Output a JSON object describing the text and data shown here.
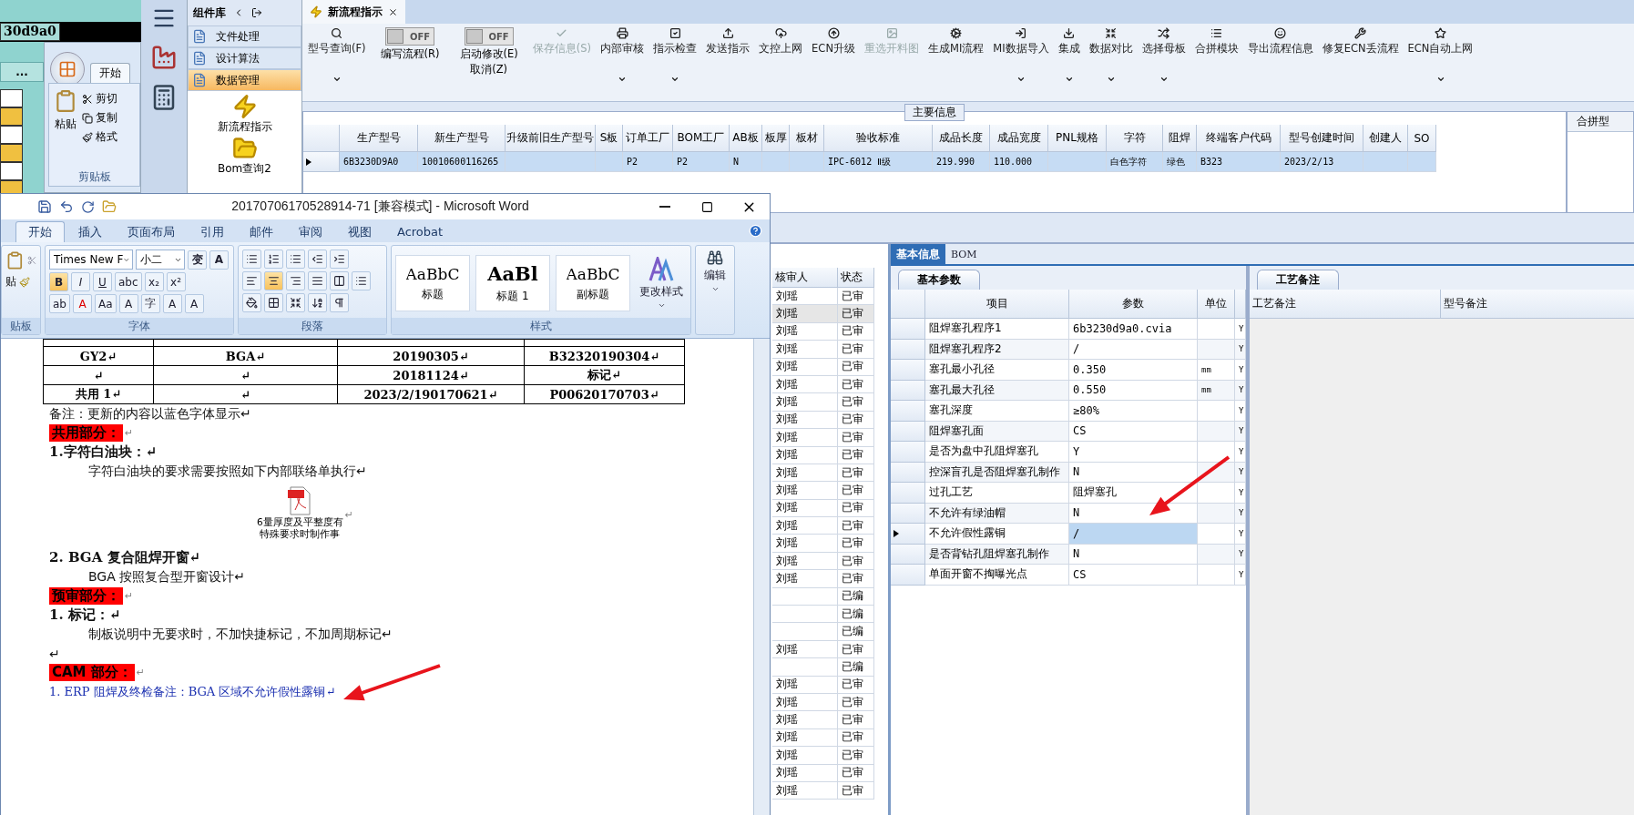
{
  "background_app": {
    "field_value": "30d9a0",
    "more_button": "...",
    "word": {
      "tab": "开始",
      "paste": "粘贴",
      "clipboard_items": [
        "剪切",
        "复制",
        "格式"
      ],
      "group": "剪贴板"
    }
  },
  "component_library": {
    "title": "组件库",
    "items": [
      {
        "label": "文件处理",
        "selected": false
      },
      {
        "label": "设计算法",
        "selected": false
      },
      {
        "label": "数据管理",
        "selected": true
      }
    ],
    "shortcuts": [
      "新流程指示",
      "Bom查询2"
    ]
  },
  "main": {
    "tab": {
      "title": "新流程指示"
    },
    "toolbar": [
      {
        "kind": "button",
        "label": "型号查询(F)",
        "dropdown": true,
        "disabled": false
      },
      {
        "kind": "toggle",
        "text": "OFF",
        "on": false,
        "lines": [
          "编写流程(R)"
        ]
      },
      {
        "kind": "toggle",
        "text": "OFF",
        "on": false,
        "lines": [
          "启动修改(E)",
          "取消(Z)"
        ]
      },
      {
        "kind": "button",
        "label": "保存信息(S)",
        "dropdown": false,
        "disabled": true
      },
      {
        "kind": "button",
        "label": "内部审核",
        "dropdown": true,
        "disabled": false
      },
      {
        "kind": "button",
        "label": "指示检查",
        "dropdown": true,
        "disabled": false
      },
      {
        "kind": "button",
        "label": "发送指示",
        "dropdown": false,
        "disabled": false
      },
      {
        "kind": "button",
        "label": "文控上网",
        "dropdown": false,
        "disabled": false
      },
      {
        "kind": "button",
        "label": "ECN升级",
        "dropdown": false,
        "disabled": false
      },
      {
        "kind": "button",
        "label": "重选开料图",
        "dropdown": false,
        "disabled": true
      },
      {
        "kind": "button",
        "label": "生成MI流程",
        "dropdown": false,
        "disabled": false
      },
      {
        "kind": "button",
        "label": "MI数据导入",
        "dropdown": true,
        "disabled": false
      },
      {
        "kind": "button",
        "label": "集成",
        "dropdown": true,
        "disabled": false
      },
      {
        "kind": "button",
        "label": "数据对比",
        "dropdown": true,
        "disabled": false
      },
      {
        "kind": "button",
        "label": "选择母板",
        "dropdown": true,
        "disabled": false
      },
      {
        "kind": "button",
        "label": "合拼模块",
        "dropdown": false,
        "disabled": false
      },
      {
        "kind": "button",
        "label": "导出流程信息",
        "dropdown": false,
        "disabled": false
      },
      {
        "kind": "button",
        "label": "修复ECN丢流程",
        "dropdown": false,
        "disabled": false
      },
      {
        "kind": "button",
        "label": "ECN自动上网",
        "dropdown": true,
        "disabled": false
      }
    ],
    "main_info": {
      "title": "主要信息",
      "columns": [
        "生产型号",
        "新生产型号",
        "升级前旧生产型号",
        "S板",
        "订单工厂",
        "BOM工厂",
        "AB板",
        "板厚",
        "板材",
        "验收标准",
        "成品长度",
        "成品宽度",
        "PNL规格",
        "字符",
        "阻焊",
        "终端客户代码",
        "型号创建时间",
        "创建人",
        "SO"
      ],
      "rows": [
        {
          "selected": true,
          "cells": [
            "6B3230D9A0",
            "10010600116265",
            "",
            "",
            "P2",
            "P2",
            "N",
            "",
            "",
            "IPC-6012 Ⅱ级",
            "219.990",
            "110.000",
            "",
            "白色字符",
            "绿色",
            "B323",
            "2023/2/13",
            "",
            ""
          ]
        }
      ]
    },
    "side_panel": {
      "title": "合拼型"
    }
  },
  "review_list": {
    "columns": [
      "核审人",
      "状态"
    ],
    "rows": [
      {
        "cells": [
          "刘瑶",
          "已审"
        ],
        "selected": false
      },
      {
        "cells": [
          "刘瑶",
          "已审"
        ],
        "selected": true
      },
      {
        "cells": [
          "刘瑶",
          "已审"
        ],
        "selected": false
      },
      {
        "cells": [
          "刘瑶",
          "已审"
        ],
        "selected": false
      },
      {
        "cells": [
          "刘瑶",
          "已审"
        ],
        "selected": false
      },
      {
        "cells": [
          "刘瑶",
          "已审"
        ],
        "selected": false
      },
      {
        "cells": [
          "刘瑶",
          "已审"
        ],
        "selected": false
      },
      {
        "cells": [
          "刘瑶",
          "已审"
        ],
        "selected": false
      },
      {
        "cells": [
          "刘瑶",
          "已审"
        ],
        "selected": false
      },
      {
        "cells": [
          "刘瑶",
          "已审"
        ],
        "selected": false
      },
      {
        "cells": [
          "刘瑶",
          "已审"
        ],
        "selected": false
      },
      {
        "cells": [
          "刘瑶",
          "已审"
        ],
        "selected": false
      },
      {
        "cells": [
          "刘瑶",
          "已审"
        ],
        "selected": false
      },
      {
        "cells": [
          "刘瑶",
          "已审"
        ],
        "selected": false
      },
      {
        "cells": [
          "刘瑶",
          "已审"
        ],
        "selected": false
      },
      {
        "cells": [
          "刘瑶",
          "已审"
        ],
        "selected": false
      },
      {
        "cells": [
          "刘瑶",
          "已审"
        ],
        "selected": false
      },
      {
        "cells": [
          "",
          "已编"
        ],
        "selected": false
      },
      {
        "cells": [
          "",
          "已编"
        ],
        "selected": false
      },
      {
        "cells": [
          "",
          "已编"
        ],
        "selected": false
      },
      {
        "cells": [
          "刘瑶",
          "已审"
        ],
        "selected": false
      },
      {
        "cells": [
          "",
          "已编"
        ],
        "selected": false
      },
      {
        "cells": [
          "刘瑶",
          "已审"
        ],
        "selected": false
      },
      {
        "cells": [
          "刘瑶",
          "已审"
        ],
        "selected": false
      },
      {
        "cells": [
          "刘瑶",
          "已审"
        ],
        "selected": false
      },
      {
        "cells": [
          "刘瑶",
          "已审"
        ],
        "selected": false
      },
      {
        "cells": [
          "刘瑶",
          "已审"
        ],
        "selected": false
      },
      {
        "cells": [
          "刘瑶",
          "已审"
        ],
        "selected": false
      },
      {
        "cells": [
          "刘瑶",
          "已审"
        ],
        "selected": false
      }
    ]
  },
  "detail": {
    "tabs": [
      {
        "label": "基本信息",
        "selected": true
      },
      {
        "label": "BOM",
        "selected": false
      }
    ],
    "params": {
      "tab": "基本参数",
      "columns": [
        "项目",
        "参数",
        "单位"
      ],
      "rows": [
        {
          "cells": [
            "阻焊塞孔程序1",
            "6b3230d9a0.cvia",
            "",
            "Y"
          ],
          "selected": false
        },
        {
          "cells": [
            "阻焊塞孔程序2",
            "/",
            "",
            "Y"
          ],
          "selected": false
        },
        {
          "cells": [
            "塞孔最小孔径",
            "0.350",
            "mm",
            "Y"
          ],
          "selected": false
        },
        {
          "cells": [
            "塞孔最大孔径",
            "0.550",
            "mm",
            "Y"
          ],
          "selected": false
        },
        {
          "cells": [
            "塞孔深度",
            "≥80%",
            "",
            "Y"
          ],
          "selected": false
        },
        {
          "cells": [
            "阻焊塞孔面",
            "CS",
            "",
            "Y"
          ],
          "selected": false
        },
        {
          "cells": [
            "是否为盘中孔阻焊塞孔",
            "Y",
            "",
            "Y"
          ],
          "selected": false
        },
        {
          "cells": [
            "控深盲孔是否阻焊塞孔制作",
            "N",
            "",
            "Y"
          ],
          "selected": false
        },
        {
          "cells": [
            "过孔工艺",
            "阻焊塞孔",
            "",
            "Y"
          ],
          "selected": false
        },
        {
          "cells": [
            "不允许有绿油帽",
            "N",
            "",
            "Y"
          ],
          "selected": false
        },
        {
          "cells": [
            "不允许假性露铜",
            "/",
            "",
            "Y"
          ],
          "selected": true
        },
        {
          "cells": [
            "是否背钻孔阻焊塞孔制作",
            "N",
            "",
            "Y"
          ],
          "selected": false
        },
        {
          "cells": [
            "单面开窗不掏曝光点",
            "CS",
            "",
            "Y"
          ],
          "selected": false
        }
      ]
    },
    "notes": {
      "tab": "工艺备注",
      "columns": [
        "工艺备注",
        "型号备注"
      ]
    }
  },
  "word": {
    "title": "20170706170528914-71 [兼容模式] - Microsoft Word",
    "tabs": [
      {
        "label": "开始",
        "selected": true
      },
      {
        "label": "插入",
        "selected": false
      },
      {
        "label": "页面布局",
        "selected": false
      },
      {
        "label": "引用",
        "selected": false
      },
      {
        "label": "邮件",
        "selected": false
      },
      {
        "label": "审阅",
        "selected": false
      },
      {
        "label": "视图",
        "selected": false
      },
      {
        "label": "Acrobat",
        "selected": false
      }
    ],
    "ribbon": {
      "paste": "贴",
      "font_name": "Times New F",
      "font_size": "小二",
      "font_row1": [
        "变",
        "A"
      ],
      "font_row2": [
        "B",
        "I",
        "U",
        "abc",
        "x₂",
        "x²"
      ],
      "font_row3": [
        "ab",
        "A",
        "Aa",
        "A",
        "字",
        "A",
        "A"
      ],
      "styles": [
        {
          "sample": "AaBbC",
          "name": "标题"
        },
        {
          "sample": "AaBl",
          "name": "标题 1"
        },
        {
          "sample": "AaBbC",
          "name": "副标题"
        }
      ],
      "change_styles": "更改样式",
      "edit": "编辑",
      "groups": [
        "贴板",
        "字体",
        "段落",
        "样式"
      ]
    },
    "table": [
      [
        "GY2↵",
        "BGA↵",
        "20190305↵",
        "B32320190304↵"
      ],
      [
        "↵",
        "↵",
        "20181124↵",
        "标记↵"
      ],
      [
        "共用 1↵",
        "↵",
        "2023/2/190170621↵",
        "P00620170703↵"
      ]
    ],
    "paragraphs": [
      {
        "kind": "note",
        "text": "备注：更新的内容以蓝色字体显示↵"
      },
      {
        "kind": "section",
        "text": "共用部分：",
        "mark": "↵"
      },
      {
        "kind": "heading",
        "text": "1.字符白油块：↵"
      },
      {
        "kind": "body",
        "text": "字符白油块的要求需要按照如下内部联络单执行↵"
      },
      {
        "kind": "attachment",
        "caption": [
          "6量厚度及平整度有",
          "特殊要求时制作事"
        ],
        "mark": "↵"
      },
      {
        "kind": "heading",
        "text": "2. BGA 复合阻焊开窗↵"
      },
      {
        "kind": "body",
        "text": "BGA 按照复合型开窗设计↵"
      },
      {
        "kind": "section",
        "text": "预审部分：",
        "mark": "↵"
      },
      {
        "kind": "heading",
        "text": "1. 标记：↵"
      },
      {
        "kind": "body",
        "text": "制板说明中无要求时，不加快捷标记，不加周期标记↵"
      },
      {
        "kind": "note",
        "text": "↵"
      },
      {
        "kind": "section",
        "text": "CAM 部分：",
        "mark": "↵"
      },
      {
        "kind": "blue",
        "text": "1. ERP 阻焊及终检备注：BGA 区域不允许假性露铜↵"
      }
    ]
  }
}
